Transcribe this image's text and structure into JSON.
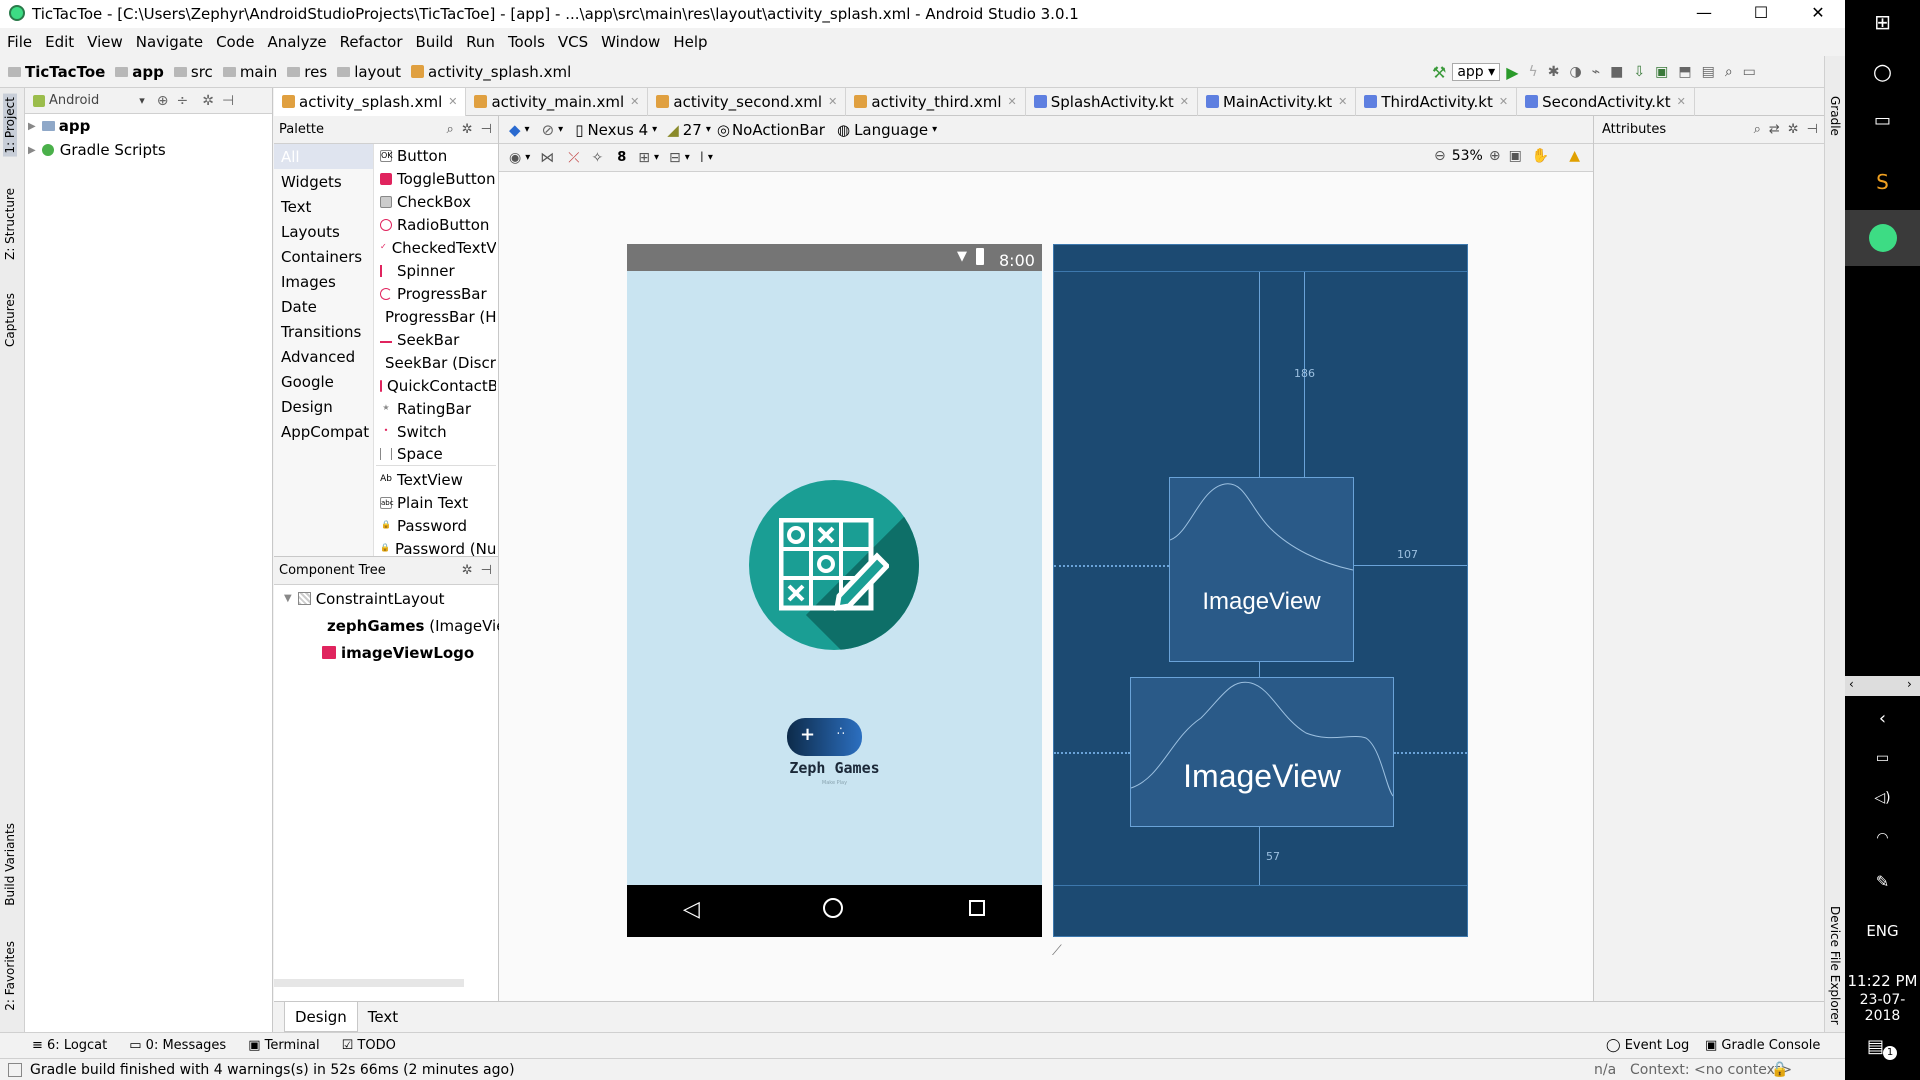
{
  "window": {
    "title": "TicTacToe - [C:\\Users\\Zephyr\\AndroidStudioProjects\\TicTacToe] - [app] - ...\\app\\src\\main\\res\\layout\\activity_splash.xml - Android Studio 3.0.1",
    "minimize": "—",
    "maximize": "☐",
    "close": "✕"
  },
  "menu": [
    "File",
    "Edit",
    "View",
    "Navigate",
    "Code",
    "Analyze",
    "Refactor",
    "Build",
    "Run",
    "Tools",
    "VCS",
    "Window",
    "Help"
  ],
  "breadcrumb": [
    "TicTacToe",
    "app",
    "src",
    "main",
    "res",
    "layout",
    "activity_splash.xml"
  ],
  "run_config": "app",
  "left_strip": {
    "project": "1: Project",
    "structure": "Z: Structure",
    "captures": "Captures",
    "build_variants": "Build Variants",
    "favorites": "2: Favorites"
  },
  "right_strip": {
    "gradle": "Gradle",
    "device_file_explorer": "Device File Explorer"
  },
  "project_panel": {
    "view_mode": "Android",
    "items": [
      {
        "label": "app"
      },
      {
        "label": "Gradle Scripts"
      }
    ]
  },
  "editor_tabs": [
    {
      "label": "activity_splash.xml",
      "active": true
    },
    {
      "label": "activity_main.xml"
    },
    {
      "label": "activity_second.xml"
    },
    {
      "label": "activity_third.xml"
    },
    {
      "label": "SplashActivity.kt"
    },
    {
      "label": "MainActivity.kt"
    },
    {
      "label": "ThirdActivity.kt"
    },
    {
      "label": "SecondActivity.kt"
    }
  ],
  "palette": {
    "title": "Palette",
    "categories": [
      "All",
      "Widgets",
      "Text",
      "Layouts",
      "Containers",
      "Images",
      "Date",
      "Transitions",
      "Advanced",
      "Google",
      "Design",
      "AppCompat"
    ],
    "items": [
      "Button",
      "ToggleButton",
      "CheckBox",
      "RadioButton",
      "CheckedTextView",
      "Spinner",
      "ProgressBar",
      "ProgressBar (Horizontal)",
      "SeekBar",
      "SeekBar (Discrete)",
      "QuickContactBadge",
      "RatingBar",
      "Switch",
      "Space",
      "TextView",
      "Plain Text",
      "Password",
      "Password (Numeric)"
    ]
  },
  "component_tree": {
    "title": "Component Tree",
    "root": "ConstraintLayout",
    "children": [
      {
        "id": "zephGames",
        "type": "(ImageView)"
      },
      {
        "id": "imageViewLogo",
        "type": ""
      }
    ]
  },
  "design_toolbar": {
    "device": "Nexus 4",
    "api": "27",
    "theme": "NoActionBar",
    "language": "Language",
    "margin": "8",
    "zoom": "53%"
  },
  "phone": {
    "time": "8:00",
    "brand": "Zeph Games",
    "brand_tagline": "Make Play"
  },
  "blueprint": {
    "view1_label": "ImageView",
    "view2_label": "ImageView",
    "top_margin": "186",
    "right_margin": "107",
    "bottom_margin": "57"
  },
  "attributes": {
    "title": "Attributes"
  },
  "bottom_tabs": [
    {
      "label": "Design",
      "active": true
    },
    {
      "label": "Text"
    }
  ],
  "tool_windows": {
    "left": [
      {
        "label": "6: Logcat"
      },
      {
        "label": "0: Messages"
      },
      {
        "label": "Terminal"
      },
      {
        "label": "TODO"
      }
    ],
    "right": [
      {
        "label": "Event Log"
      },
      {
        "label": "Gradle Console"
      }
    ]
  },
  "status": {
    "message": "Gradle build finished with 4 warnings(s) in 52s 66ms (2 minutes ago)",
    "position": "n/a",
    "context": "Context: <no context>"
  },
  "taskbar": {
    "language": "ENG",
    "time": "11:22 PM",
    "date": "23-07-2018",
    "notifications": "1"
  },
  "colors": {
    "accent": "#0a6ed1",
    "blueprint_bg": "#1c4a72",
    "phone_bg": "#c9e4f1",
    "logo_teal": "#1a9e94",
    "image_icon": "#e0245e"
  }
}
